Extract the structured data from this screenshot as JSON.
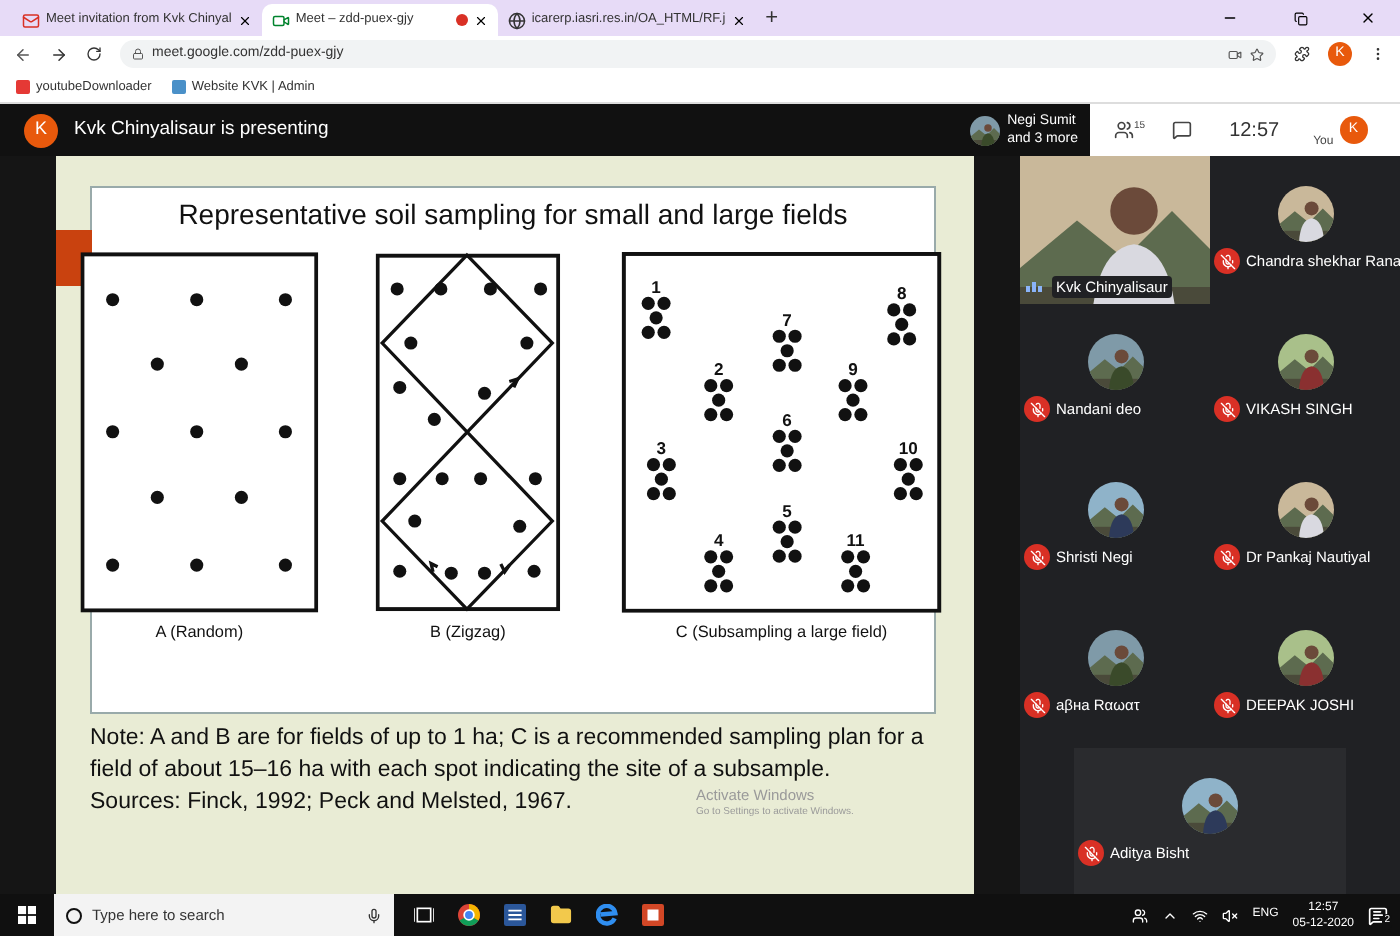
{
  "browser": {
    "tabs": [
      {
        "title": "Meet invitation from Kvk Chinyal",
        "kind": "mail",
        "selected": false,
        "recording": false
      },
      {
        "title": "Meet – zdd-puex-gjy",
        "kind": "meet",
        "selected": true,
        "recording": true
      },
      {
        "title": "icarerp.iasri.res.in/OA_HTML/RF.j",
        "kind": "web",
        "selected": false,
        "recording": false
      }
    ],
    "new_tab": "+",
    "address": "meet.google.com/zdd-puex-gjy",
    "profile": "K",
    "bookmarks": [
      "youtubeDownloader",
      "Website KVK | Admin"
    ]
  },
  "meeting": {
    "presenter_avatar": "K",
    "presenting": "Kvk Chinyalisaur is presenting",
    "joined": [
      "Negi Sumit",
      "and 3 more"
    ],
    "people_count": "15",
    "time": "12:57",
    "you_label": "You",
    "you_avatar": "K"
  },
  "slide": {
    "title": "Representative soil sampling for small and large fields",
    "panels": [
      {
        "kind": "random",
        "caption": "A (Random)"
      },
      {
        "kind": "zigzag",
        "caption": "B (Zigzag)"
      },
      {
        "kind": "clusters",
        "caption": "C (Subsampling a large field)",
        "labels": [
          "1",
          "8",
          "7",
          "2",
          "9",
          "6",
          "3",
          "10",
          "5",
          "4",
          "11"
        ]
      }
    ],
    "note": "Note: A and B are for fields of up to 1 ha; C is a recommended sampling plan for a field of about 15–16 ha with each spot indicating the site of a subsample.",
    "sources": "Sources: Finck, 1992; Peck and Melsted, 1967."
  },
  "os_notice": [
    "Activate Windows",
    "Go to Settings to activate Windows."
  ],
  "participants": [
    {
      "name": "Kvk Chinyalisaur",
      "kind": "video",
      "muted": false
    },
    {
      "name": "Chandra shekhar Rana",
      "kind": "avatar",
      "muted": true
    },
    {
      "name": "Nandani deo",
      "kind": "avatar",
      "muted": true
    },
    {
      "name": "VIKASH SINGH",
      "kind": "avatar",
      "muted": true
    },
    {
      "name": "Shristi Negi",
      "kind": "avatar",
      "muted": true
    },
    {
      "name": "Dr Pankaj Nautiyal",
      "kind": "avatar",
      "muted": true
    },
    {
      "name": "aβнa Rαωατ",
      "kind": "avatar",
      "muted": true
    },
    {
      "name": "DEEPAK JOSHI",
      "kind": "avatar",
      "muted": true
    },
    {
      "name": "Aditya Bisht",
      "kind": "avatar",
      "muted": true
    }
  ],
  "taskbar": {
    "search_placeholder": "Type here to search",
    "language": "ENG",
    "time": "12:57",
    "date": "05-12-2020",
    "notifications": "2"
  }
}
